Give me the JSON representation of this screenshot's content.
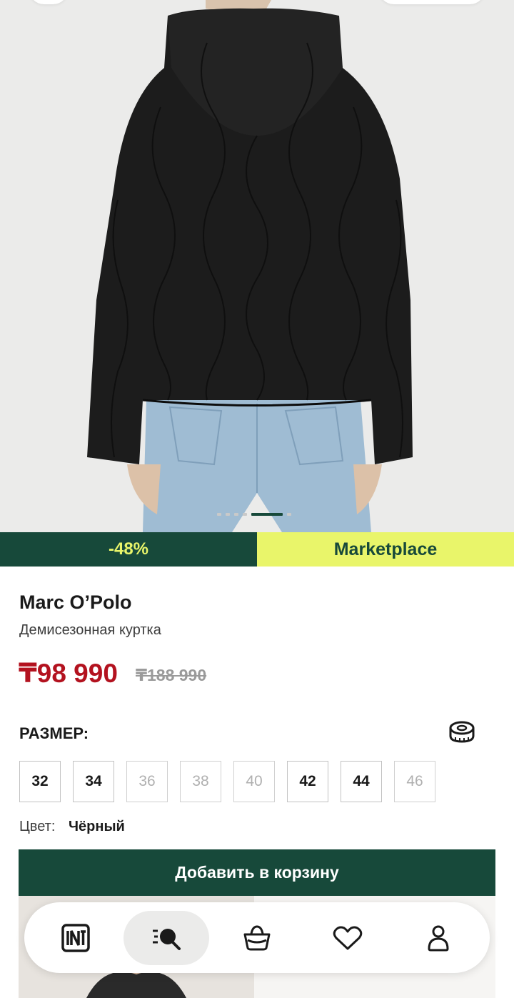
{
  "product": {
    "brand": "Marc O’Polo",
    "name": "Демисезонная куртка",
    "price": "₸98 990",
    "old_price": "₸188 990",
    "discount_badge": "-48%",
    "marketplace_badge": "Marketplace"
  },
  "gallery": {
    "image_count": 6,
    "active_index": 4
  },
  "size": {
    "label": "РАЗМЕР:",
    "options": [
      {
        "value": "32",
        "available": true
      },
      {
        "value": "34",
        "available": true
      },
      {
        "value": "36",
        "available": false
      },
      {
        "value": "38",
        "available": false
      },
      {
        "value": "40",
        "available": false
      },
      {
        "value": "42",
        "available": true
      },
      {
        "value": "44",
        "available": true
      },
      {
        "value": "46",
        "available": false
      }
    ]
  },
  "color": {
    "label": "Цвет:",
    "value": "Чёрный"
  },
  "cart": {
    "add_label": "Добавить в корзину"
  },
  "nav": {
    "items": [
      {
        "icon": "store-logo-icon",
        "active": false
      },
      {
        "icon": "catalog-search-icon",
        "active": true
      },
      {
        "icon": "basket-icon",
        "active": false
      },
      {
        "icon": "heart-icon",
        "active": false
      },
      {
        "icon": "profile-icon",
        "active": false
      }
    ]
  },
  "colors": {
    "brand_green": "#17493a",
    "accent_yellow": "#e9f56a",
    "sale_red": "#b3121f"
  }
}
